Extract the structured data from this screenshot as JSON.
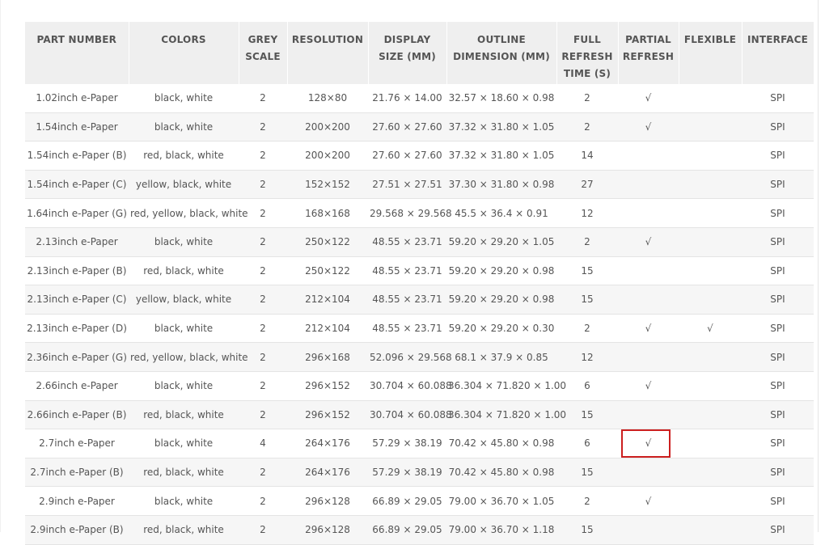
{
  "table": {
    "headers": [
      "PART NUMBER",
      "COLORS",
      "GREY SCALE",
      "RESOLUTION",
      "DISPLAY SIZE (MM)",
      "OUTLINE DIMENSION (MM)",
      "FULL REFRESH TIME (S)",
      "PARTIAL REFRESH",
      "FLEXIBLE",
      "INTERFACE"
    ],
    "rows": [
      {
        "part": "1.02inch e-Paper",
        "colors": "black, white",
        "grey": "2",
        "res": "128×80",
        "display": "21.76 × 14.00",
        "outline": "32.57 × 18.60 × 0.98",
        "refresh": "2",
        "partial": "√",
        "flexible": "",
        "iface": "SPI"
      },
      {
        "part": "1.54inch e-Paper",
        "colors": "black, white",
        "grey": "2",
        "res": "200×200",
        "display": "27.60 × 27.60",
        "outline": "37.32 × 31.80 × 1.05",
        "refresh": "2",
        "partial": "√",
        "flexible": "",
        "iface": "SPI"
      },
      {
        "part": "1.54inch e-Paper (B)",
        "colors": "red, black, white",
        "grey": "2",
        "res": "200×200",
        "display": "27.60 × 27.60",
        "outline": "37.32 × 31.80 × 1.05",
        "refresh": "14",
        "partial": "",
        "flexible": "",
        "iface": "SPI"
      },
      {
        "part": "1.54inch e-Paper (C)",
        "colors": "yellow, black, white",
        "grey": "2",
        "res": "152×152",
        "display": "27.51 × 27.51",
        "outline": "37.30 × 31.80 × 0.98",
        "refresh": "27",
        "partial": "",
        "flexible": "",
        "iface": "SPI"
      },
      {
        "part": "1.64inch e-Paper (G)",
        "colors": "red, yellow, black, white",
        "grey": "2",
        "res": "168×168",
        "display": "29.568 × 29.568",
        "outline": "45.5 × 36.4 × 0.91",
        "refresh": "12",
        "partial": "",
        "flexible": "",
        "iface": "SPI"
      },
      {
        "part": "2.13inch e-Paper",
        "colors": "black, white",
        "grey": "2",
        "res": "250×122",
        "display": "48.55 × 23.71",
        "outline": "59.20 × 29.20 × 1.05",
        "refresh": "2",
        "partial": "√",
        "flexible": "",
        "iface": "SPI"
      },
      {
        "part": "2.13inch e-Paper (B)",
        "colors": "red, black, white",
        "grey": "2",
        "res": "250×122",
        "display": "48.55 × 23.71",
        "outline": "59.20 × 29.20 × 0.98",
        "refresh": "15",
        "partial": "",
        "flexible": "",
        "iface": "SPI"
      },
      {
        "part": "2.13inch e-Paper (C)",
        "colors": "yellow, black, white",
        "grey": "2",
        "res": "212×104",
        "display": "48.55 × 23.71",
        "outline": "59.20 × 29.20 × 0.98",
        "refresh": "15",
        "partial": "",
        "flexible": "",
        "iface": "SPI"
      },
      {
        "part": "2.13inch e-Paper (D)",
        "colors": "black, white",
        "grey": "2",
        "res": "212×104",
        "display": "48.55 × 23.71",
        "outline": "59.20 × 29.20 × 0.30",
        "refresh": "2",
        "partial": "√",
        "flexible": "√",
        "iface": "SPI"
      },
      {
        "part": "2.36inch e-Paper (G)",
        "colors": "red, yellow, black, white",
        "grey": "2",
        "res": "296×168",
        "display": "52.096 × 29.568",
        "outline": "68.1 × 37.9 × 0.85",
        "refresh": "12",
        "partial": "",
        "flexible": "",
        "iface": "SPI"
      },
      {
        "part": "2.66inch e-Paper",
        "colors": "black, white",
        "grey": "2",
        "res": "296×152",
        "display": "30.704 × 60.088",
        "outline": "36.304 × 71.820 × 1.00",
        "refresh": "6",
        "partial": "√",
        "flexible": "",
        "iface": "SPI"
      },
      {
        "part": "2.66inch e-Paper (B)",
        "colors": "red, black, white",
        "grey": "2",
        "res": "296×152",
        "display": "30.704 × 60.088",
        "outline": "36.304 × 71.820 × 1.00",
        "refresh": "15",
        "partial": "",
        "flexible": "",
        "iface": "SPI"
      },
      {
        "part": "2.7inch e-Paper",
        "colors": "black, white",
        "grey": "4",
        "res": "264×176",
        "display": "57.29 × 38.19",
        "outline": "70.42 × 45.80 × 0.98",
        "refresh": "6",
        "partial": "√",
        "flexible": "",
        "iface": "SPI"
      },
      {
        "part": "2.7inch e-Paper (B)",
        "colors": "red, black, white",
        "grey": "2",
        "res": "264×176",
        "display": "57.29 × 38.19",
        "outline": "70.42 × 45.80 × 0.98",
        "refresh": "15",
        "partial": "",
        "flexible": "",
        "iface": "SPI"
      },
      {
        "part": "2.9inch e-Paper",
        "colors": "black, white",
        "grey": "2",
        "res": "296×128",
        "display": "66.89 × 29.05",
        "outline": "79.00 × 36.70 × 1.05",
        "refresh": "2",
        "partial": "√",
        "flexible": "",
        "iface": "SPI"
      },
      {
        "part": "2.9inch e-Paper (B)",
        "colors": "red, black, white",
        "grey": "2",
        "res": "296×128",
        "display": "66.89 × 29.05",
        "outline": "79.00 × 36.70 × 1.18",
        "refresh": "15",
        "partial": "",
        "flexible": "",
        "iface": "SPI"
      }
    ]
  },
  "colors": {
    "link": "#8aa83a",
    "highlight": "#cc1f1f",
    "header_bg": "#efefef"
  }
}
